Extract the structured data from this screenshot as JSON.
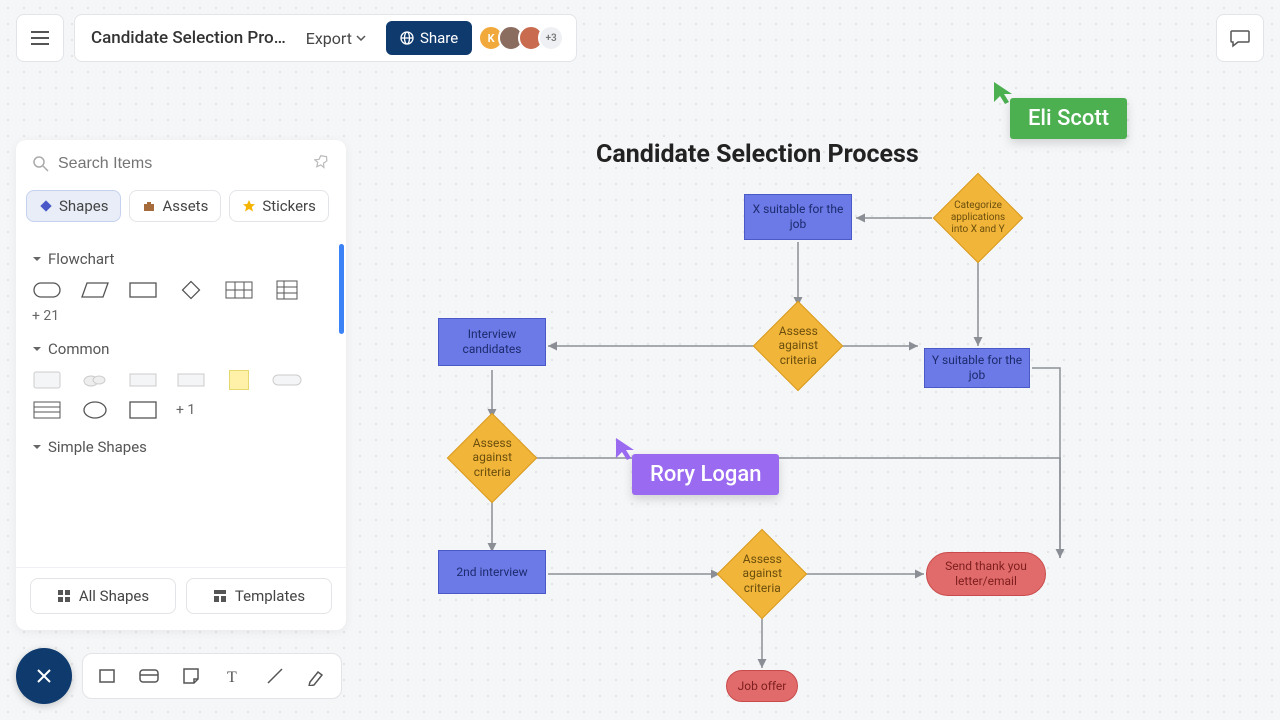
{
  "header": {
    "doc_title": "Candidate Selection Pro…",
    "export_label": "Export",
    "share_label": "Share",
    "extra_users": "+3"
  },
  "panel": {
    "search_placeholder": "Search Items",
    "tabs": {
      "shapes": "Shapes",
      "assets": "Assets",
      "stickers": "Stickers"
    },
    "sections": {
      "flowchart": "Flowchart",
      "flowchart_more": "+ 21",
      "common": "Common",
      "common_more": "+ 1",
      "simple": "Simple Shapes"
    },
    "footer": {
      "all_shapes": "All Shapes",
      "templates": "Templates"
    }
  },
  "canvas": {
    "title": "Candidate Selection Process",
    "nodes": {
      "x_suitable": "X suitable for the job",
      "y_suitable": "Y suitable for the job",
      "categorize": "Categorize applications into X and Y",
      "assess1": "Assess against criteria",
      "assess2": "Assess against criteria",
      "assess3": "Assess against criteria",
      "interview": "Interview candidates",
      "second_interview": "2nd interview",
      "thankyou": "Send thank you letter/email",
      "job_offer": "Job offer"
    },
    "cursors": {
      "user1": "Eli Scott",
      "user2": "Rory Logan"
    },
    "colors": {
      "user1": "#4caf50",
      "user2": "#9a6af0",
      "rect_blue": "#6b7ae6",
      "diamond": "#f1b539",
      "capsule_red": "#e16b6b"
    }
  }
}
